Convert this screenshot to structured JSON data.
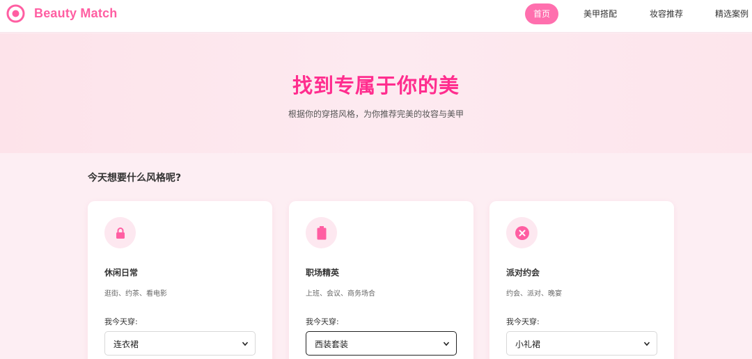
{
  "header": {
    "logo_text": "Beauty Match",
    "nav": [
      {
        "label": "首页",
        "active": true
      },
      {
        "label": "美甲搭配",
        "active": false
      },
      {
        "label": "妆容推荐",
        "active": false
      },
      {
        "label": "精选案例",
        "active": false
      }
    ]
  },
  "hero": {
    "title": "找到专属于你的美",
    "subtitle": "根据你的穿搭风格，为你推荐完美的妆容与美甲"
  },
  "section": {
    "title": "今天想要什么风格呢?"
  },
  "cards": [
    {
      "icon": "lock-icon",
      "title": "休闲日常",
      "description": "逛街、约茶、看电影",
      "wear_label": "我今天穿:",
      "selected": "连衣裙"
    },
    {
      "icon": "battery-icon",
      "title": "职场精英",
      "description": "上班、会议、商务场合",
      "wear_label": "我今天穿:",
      "selected": "西装套装"
    },
    {
      "icon": "close-circle-icon",
      "title": "派对约会",
      "description": "约会、派对、晚宴",
      "wear_label": "我今天穿:",
      "selected": "小礼裙"
    }
  ],
  "colors": {
    "brand": "#ff5ea2",
    "accent": "#ff2d8e",
    "nav_active": "#ff6fae",
    "icon_bg": "#fde8f0"
  }
}
